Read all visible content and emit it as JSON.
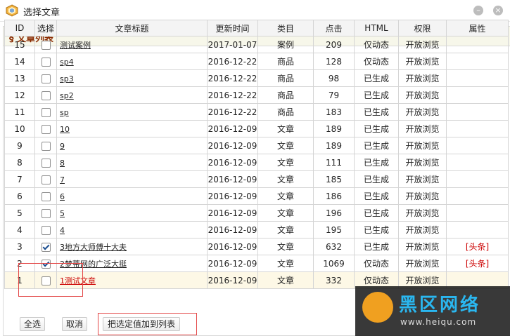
{
  "window": {
    "title": "选择文章",
    "min_glyph": "–",
    "close_glyph": "×"
  },
  "panel": {
    "title": "§ 文章列表"
  },
  "table": {
    "headers": [
      "ID",
      "选择",
      "文章标题",
      "更新时间",
      "类目",
      "点击",
      "HTML",
      "权限",
      "属性"
    ],
    "rows": [
      {
        "id": "15",
        "checked": false,
        "title": "测试案例",
        "date": "2017-01-07",
        "cat": "案例",
        "clicks": "209",
        "html": "仅动态",
        "perm": "开放浏览",
        "attr": ""
      },
      {
        "id": "14",
        "checked": false,
        "title": "sp4",
        "date": "2016-12-22",
        "cat": "商品",
        "clicks": "128",
        "html": "仅动态",
        "perm": "开放浏览",
        "attr": ""
      },
      {
        "id": "13",
        "checked": false,
        "title": "sp3",
        "date": "2016-12-22",
        "cat": "商品",
        "clicks": "98",
        "html": "已生成",
        "perm": "开放浏览",
        "attr": ""
      },
      {
        "id": "12",
        "checked": false,
        "title": "sp2",
        "date": "2016-12-22",
        "cat": "商品",
        "clicks": "79",
        "html": "已生成",
        "perm": "开放浏览",
        "attr": ""
      },
      {
        "id": "11",
        "checked": false,
        "title": "sp",
        "date": "2016-12-22",
        "cat": "商品",
        "clicks": "183",
        "html": "已生成",
        "perm": "开放浏览",
        "attr": ""
      },
      {
        "id": "10",
        "checked": false,
        "title": "10",
        "date": "2016-12-09",
        "cat": "文章",
        "clicks": "189",
        "html": "已生成",
        "perm": "开放浏览",
        "attr": ""
      },
      {
        "id": "9",
        "checked": false,
        "title": "9",
        "date": "2016-12-09",
        "cat": "文章",
        "clicks": "189",
        "html": "已生成",
        "perm": "开放浏览",
        "attr": ""
      },
      {
        "id": "8",
        "checked": false,
        "title": "8",
        "date": "2016-12-09",
        "cat": "文章",
        "clicks": "111",
        "html": "已生成",
        "perm": "开放浏览",
        "attr": ""
      },
      {
        "id": "7",
        "checked": false,
        "title": "7",
        "date": "2016-12-09",
        "cat": "文章",
        "clicks": "185",
        "html": "已生成",
        "perm": "开放浏览",
        "attr": ""
      },
      {
        "id": "6",
        "checked": false,
        "title": "6",
        "date": "2016-12-09",
        "cat": "文章",
        "clicks": "186",
        "html": "已生成",
        "perm": "开放浏览",
        "attr": ""
      },
      {
        "id": "5",
        "checked": false,
        "title": "5",
        "date": "2016-12-09",
        "cat": "文章",
        "clicks": "196",
        "html": "已生成",
        "perm": "开放浏览",
        "attr": ""
      },
      {
        "id": "4",
        "checked": false,
        "title": "4",
        "date": "2016-12-09",
        "cat": "文章",
        "clicks": "195",
        "html": "已生成",
        "perm": "开放浏览",
        "attr": ""
      },
      {
        "id": "3",
        "checked": true,
        "title": "3地方大师傅十大夫",
        "date": "2016-12-09",
        "cat": "文章",
        "clicks": "632",
        "html": "已生成",
        "perm": "开放浏览",
        "attr": "[头条]"
      },
      {
        "id": "2",
        "checked": true,
        "title": "2梦蒂网的广泛大挺",
        "date": "2016-12-09",
        "cat": "文章",
        "clicks": "1069",
        "html": "仅动态",
        "perm": "开放浏览",
        "attr": "[头条]"
      },
      {
        "id": "1",
        "checked": false,
        "title": "1测试文章",
        "date": "2016-12-09",
        "cat": "文章",
        "clicks": "332",
        "html": "仅动态",
        "perm": "开放浏览",
        "attr": ""
      }
    ]
  },
  "buttons": {
    "select_all": "全选",
    "cancel": "取消",
    "add_to_list": "把选定值加到列表"
  },
  "watermark": {
    "text": "黑区网络",
    "url": "www.heiqu.com"
  },
  "colors": {
    "title_red": "#8a2a00",
    "attr_red": "#cc0000",
    "highlight_row": "#fdf8e6"
  }
}
